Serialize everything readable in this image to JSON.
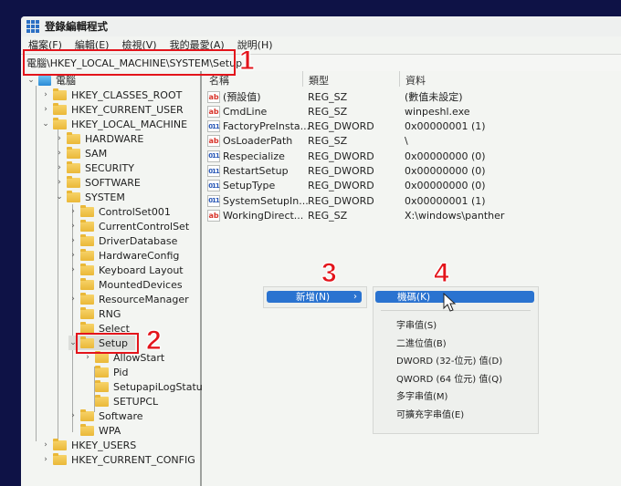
{
  "window": {
    "title": "登錄編輯程式"
  },
  "menu": [
    "檔案(F)",
    "編輯(E)",
    "檢視(V)",
    "我的最愛(A)",
    "說明(H)"
  ],
  "address": "電腦\\HKEY_LOCAL_MACHINE\\SYSTEM\\Setup",
  "tree": {
    "root": "電腦",
    "hives": [
      "HKEY_CLASSES_ROOT",
      "HKEY_CURRENT_USER",
      "HKEY_LOCAL_MACHINE"
    ],
    "hklm_children": [
      "HARDWARE",
      "SAM",
      "SECURITY",
      "SOFTWARE",
      "SYSTEM"
    ],
    "system_children": [
      "ControlSet001",
      "CurrentControlSet",
      "DriverDatabase",
      "HardwareConfig",
      "Keyboard Layout",
      "MountedDevices",
      "ResourceManager",
      "RNG",
      "Select",
      "Setup"
    ],
    "setup_children": [
      "AllowStart",
      "Pid",
      "SetupapiLogStatus",
      "SETUPCL"
    ],
    "system_after": [
      "Software",
      "WPA"
    ],
    "hives_after": [
      "HKEY_USERS",
      "HKEY_CURRENT_CONFIG"
    ],
    "selected": "Setup"
  },
  "list": {
    "headers": {
      "name": "名稱",
      "type": "類型",
      "data": "資料"
    },
    "rows": [
      {
        "icon": "string-value-icon",
        "name": "(預設值)",
        "type": "REG_SZ",
        "data": "(數值未設定)"
      },
      {
        "icon": "string-value-icon",
        "name": "CmdLine",
        "type": "REG_SZ",
        "data": "winpeshl.exe"
      },
      {
        "icon": "dword-value-icon",
        "name": "FactoryPreInsta...",
        "type": "REG_DWORD",
        "data": "0x00000001 (1)"
      },
      {
        "icon": "string-value-icon",
        "name": "OsLoaderPath",
        "type": "REG_SZ",
        "data": "\\"
      },
      {
        "icon": "dword-value-icon",
        "name": "Respecialize",
        "type": "REG_DWORD",
        "data": "0x00000000 (0)"
      },
      {
        "icon": "dword-value-icon",
        "name": "RestartSetup",
        "type": "REG_DWORD",
        "data": "0x00000000 (0)"
      },
      {
        "icon": "dword-value-icon",
        "name": "SetupType",
        "type": "REG_DWORD",
        "data": "0x00000000 (0)"
      },
      {
        "icon": "dword-value-icon",
        "name": "SystemSetupIn...",
        "type": "REG_DWORD",
        "data": "0x00000001 (1)"
      },
      {
        "icon": "string-value-icon",
        "name": "WorkingDirect...",
        "type": "REG_SZ",
        "data": "X:\\windows\\panther"
      }
    ]
  },
  "context_menu": {
    "new_label": "新增(N)",
    "submenu_arrow": "›",
    "submenu": {
      "key_label": "機碼(K)",
      "items": [
        "字串值(S)",
        "二進位值(B)",
        "DWORD (32-位元) 值(D)",
        "QWORD (64 位元) 值(Q)",
        "多字串值(M)",
        "可擴充字串值(E)"
      ]
    }
  },
  "annotations": [
    "1",
    "2",
    "3",
    "4"
  ],
  "colors": {
    "accent": "#2a73d0",
    "annotation": "#e3141b",
    "background": "#0e1246"
  }
}
